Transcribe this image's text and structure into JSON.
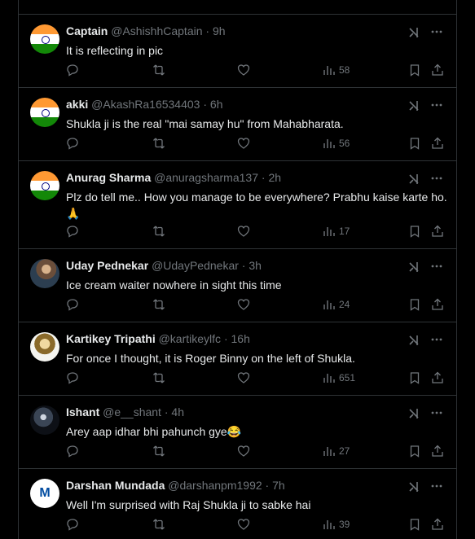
{
  "tweets": [
    {
      "name": "Captain",
      "handle": "@AshishhCaptain",
      "time": "9h",
      "text": "It is reflecting in pic",
      "views": "58",
      "avatar": "flag"
    },
    {
      "name": "akki",
      "handle": "@AkashRa16534403",
      "time": "6h",
      "text": "Shukla ji is the real \"mai samay hu\" from Mahabharata.",
      "views": "56",
      "avatar": "flag"
    },
    {
      "name": "Anurag Sharma",
      "handle": "@anuragsharma137",
      "time": "2h",
      "text": "Plz do tell me.. How you manage to be everywhere? Prabhu kaise karte ho.",
      "text2": "🙏",
      "views": "17",
      "avatar": "flag"
    },
    {
      "name": "Uday Pednekar",
      "handle": "@UdayPednekar",
      "time": "3h",
      "text": "Ice cream waiter nowhere in sight this time",
      "views": "24",
      "avatar": "photo1"
    },
    {
      "name": "Kartikey Tripathi",
      "handle": "@kartikeylfc",
      "time": "16h",
      "text": "For once I thought, it is Roger Binny on the left of Shukla.",
      "views": "651",
      "avatar": "photo2"
    },
    {
      "name": "Ishant",
      "handle": "@e__shant",
      "time": "4h",
      "text": "Arey aap idhar bhi pahunch gye😂",
      "views": "27",
      "avatar": "photo3"
    },
    {
      "name": "Darshan Mundada",
      "handle": "@darshanpm1992",
      "time": "7h",
      "text": "Well I'm surprised with Raj Shukla ji to sabke hai",
      "views": "39",
      "avatar": "logo",
      "logo_text": "M"
    }
  ],
  "separator": "·",
  "icons": {
    "reply": "reply-icon",
    "retweet": "retweet-icon",
    "like": "heart-icon",
    "views": "views-icon",
    "bookmark": "bookmark-icon",
    "share": "share-icon",
    "grok": "grok-icon",
    "more": "more-icon"
  },
  "colors": {
    "background": "#000000",
    "text": "#e7e9ea",
    "secondary": "#71767b",
    "border": "#2f3336"
  }
}
